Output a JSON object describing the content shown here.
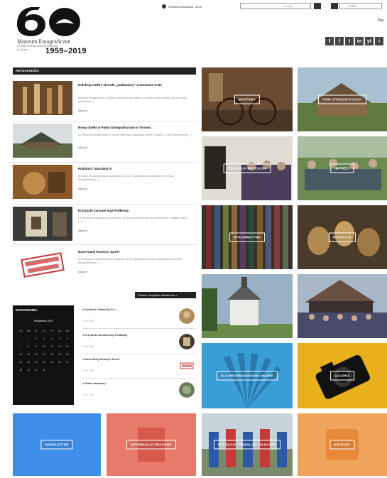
{
  "header": {
    "logo_number": "60",
    "museum_name": "Muzeum Etnograficzne",
    "museum_sub1": "im. Marii Znamierowskiej-Prüfferowej",
    "museum_sub2": "w Toruniu",
    "years": "1959–2019",
    "top_link": "Wersja kontrastowa",
    "font_tools": "A A A",
    "search_placeholder": "Szukaj",
    "lang": "Polski",
    "top_right": "Wyj"
  },
  "social": [
    "f",
    "f",
    "t",
    "in",
    "yt",
    "i"
  ],
  "news": {
    "heading": "AKTUALNOŚCI",
    "more_all": "Zobacz wszystkie aktualności »",
    "items": [
      {
        "title": "Kolekcja rzeźb z Nerodu „podwaniny” uratowanie w Bo",
        "text": "Muzeum Etnograficzne w Toruniu zakupiło nowy obiekt do kolekcji rzeźby ludowej, jest to rzeźba autorstwa [...]",
        "more": "Więcej »"
      },
      {
        "title": "Nowy obiekt w Parku Etnograficznym w Toruniu",
        "text": "Do Parku Etnograficznego w Toruniu trafił nowy zabytkowy obiekt z regionu, o czym informujemy [...]",
        "more": "Więcej »"
      },
      {
        "title": "Podsłuch Tatarskiej IV",
        "text": "W piątek 18 października w godzinach od 18.00 zapraszamy na wydarzenie w Parku Etnograficznym [...]",
        "more": "Więcej »"
      },
      {
        "title": "Krzyżacki Jarmark Kaji Podlkowy",
        "text": "28 sierpnia W zapraszamy na jarmark, na którym zaprezentują się rękodzielnicy z całego regionu [...]",
        "more": "Więcej »"
      },
      {
        "title": "Noce Kasły funorsy! Jarze?",
        "text": "W niedzielę 23 października w godzinach 11-15 zapraszamy do nas na wydarzenie w Parku Etnograficznym [...]",
        "more": "Więcej »"
      }
    ]
  },
  "calendar": {
    "title": "WYDARZENIA",
    "month": "Październik 2019",
    "weekdays": [
      "Pn",
      "Wt",
      "Śr",
      "Cz",
      "Pt",
      "So",
      "Nd"
    ],
    "days": [
      "",
      "1",
      "2",
      "3",
      "4",
      "5",
      "6",
      "7",
      "8",
      "9",
      "10",
      "11",
      "12",
      "13",
      "14",
      "15",
      "16",
      "17",
      "18",
      "19",
      "20",
      "21",
      "22",
      "23",
      "24",
      "25",
      "26",
      "27",
      "28",
      "29",
      "30",
      "31",
      "",
      "",
      ""
    ]
  },
  "events": [
    {
      "title": "● Podsłuch Tatarskiej IV's",
      "date": "18.10.2019"
    },
    {
      "title": "● Krzyżacki Jarmark Kaji Podlkowy",
      "date": "19.10.2019"
    },
    {
      "title": "● Noce Kasły funorsy! Jarze?",
      "date": "20.10.2019"
    },
    {
      "title": "● Dzikie zakamary",
      "date": "23.10.2019"
    }
  ],
  "tiles": [
    {
      "label": "WYSTAWY",
      "bg": "#7a5a3a"
    },
    {
      "label": "PARK ETNOGRAFICZNY",
      "bg": "#6f8a5a"
    },
    {
      "label": "EDUKACJA MUZEALNA",
      "bg": "#5e5548"
    },
    {
      "label": "IMPREZY",
      "bg": "#557748"
    },
    {
      "label": "WYDAWNICTWA",
      "bg": "#4a3e36"
    },
    {
      "label": "KOLEKCJE",
      "bg": "#5a4632"
    },
    {
      "label": "",
      "bg": "#8a9aa8"
    },
    {
      "label": "",
      "bg": "#3a3f50"
    },
    {
      "label": "DLA PRZEWODNIKÓW / WAŻNE",
      "bg": "#3a9ed6"
    },
    {
      "label": "GALERIA",
      "bg": "#e8b11c"
    },
    {
      "label": "NEWSLETTER",
      "bg": "#3d8ee8"
    },
    {
      "label": "INFORMACJA PRASOWA",
      "bg": "#e87a6a"
    },
    {
      "label": "KOLEKCJA PRZEGLĄD FOLKLORU",
      "bg": "#3c6fa8"
    },
    {
      "label": "KONTAKT",
      "bg": "#f0a35a"
    }
  ]
}
